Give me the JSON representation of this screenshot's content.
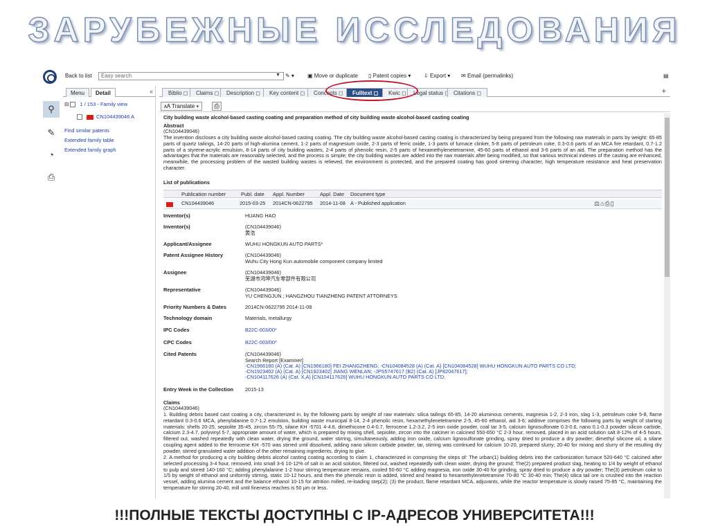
{
  "slide": {
    "title": "ЗАРУБЕЖНЫЕ  ИССЛЕДОВАНИЯ",
    "footer": "!!!ПОЛНЫЕ ТЕКСТЫ ДОСТУПНЫ С IP-АДРЕСОВ УНИВЕРСИТЕТА!!!"
  },
  "topbar": {
    "back_to_list": "Back to list",
    "search_placeholder": "Easy search",
    "move_or_duplicate": "Move or duplicate",
    "patent_copies": "Patent copies",
    "export": "Export",
    "email": "Email (permalinks)"
  },
  "leftpanel": {
    "tabs": [
      "Menu",
      "Detail"
    ],
    "collapse": "«",
    "family_label": "1 / 153 - Family view",
    "family_member": "CN104439046 A",
    "links": [
      "Find similar patents",
      "Extended family table",
      "Extended family graph"
    ]
  },
  "tabs": [
    {
      "label": "Biblio",
      "active": false
    },
    {
      "label": "Claims",
      "active": false
    },
    {
      "label": "Description",
      "active": false
    },
    {
      "label": "Key content",
      "active": false
    },
    {
      "label": "Concepts",
      "active": false
    },
    {
      "label": "Fulltext",
      "active": true
    },
    {
      "label": "Kwic",
      "active": false
    },
    {
      "label": "Legal status",
      "active": false
    },
    {
      "label": "Citations",
      "active": false
    }
  ],
  "toolbar2": {
    "translate": "Translate"
  },
  "document": {
    "title": "City building waste alcohol-based casting coating and preparation method of city building waste alcohol-based casting coating",
    "abstract_heading": "Abstract",
    "abstract_id": "(CN104439046)",
    "abstract_text": "The invention discloses a city building waste alcohol-based casting coating. The city building waste alcohol-based casting coating is characterized by being prepared from the following raw materials in parts by weight: 65-85 parts of quartz tailings, 14-20 parts of high-alumina cement, 1-2 parts of magnesium oxide, 2-3 parts of ferric oxide, 1-3 parts of furnace clinker, 5-8 parts of petroleum coke, 0.3-0.6 parts of an MCA fire retardant, 0.7-1.2 parts of a styrene-acrylic emulsion, 8-14 parts of city building wastes, 2-4 parts of phenolic resin, 2-5 parts of hexamethylenetetramine, 45-60 parts of ethanol and 3-6 parts of an aid. The preparation method has the advantages that the materials are reasonably selected, and the process is simple; the city building wastes are added into the raw materials after being modified, so that various technical indexes of the casting are enhanced, meanwhile, the processing problem of the wasted building wastes is relieved, the environment is protected, and the prepared coating has good sintering character, high temperature resistance and heat preservation character.",
    "list_heading": "List of publications",
    "pub_columns": [
      "Publication number",
      "Publ. date",
      "Appl. Number",
      "Appl. Date",
      "Document type"
    ],
    "pub_row": [
      "CN104439046",
      "2015-03-25",
      "2014CN-0622795",
      "2014-11-08",
      "A - Published application"
    ],
    "fields": [
      {
        "label": "Inventor(s)",
        "value": "HUANG HAO"
      },
      {
        "label": "Inventor(s)",
        "value": "(CN104439046)",
        "value2": "黄浩"
      },
      {
        "label": "Applicant/Assignee",
        "value": "WUHU HONGKUN AUTO PARTS*"
      },
      {
        "label": "Patent Assignee History",
        "value": "(CN104439046)",
        "value2": "Wuhu City Hong Kun automobile component company limited"
      },
      {
        "label": "Assignee",
        "value": "(CN104439046)",
        "value2": "芜湖市鸿坤汽车零部件有限公司"
      },
      {
        "label": "Representative",
        "value": "(CN104439046)",
        "value2": "YU CHENGJUN ; HANGZHOU TIANZHENG PATENT ATTORNEYS"
      },
      {
        "label": "Priority Numbers & Dates",
        "value": "2014CN-0622795 2014-11-08"
      },
      {
        "label": "Technology domain",
        "value": "Materials, metallurgy"
      },
      {
        "label": "IPC Codes",
        "value": "B22C-003/00*"
      },
      {
        "label": "CPC Codes",
        "value": "B22C-003/00*"
      }
    ],
    "cited": {
      "label": "Cited Patents",
      "id": "(CN104439046)",
      "search_report": "Search Report [Examiner]",
      "lines": [
        "-CN1966180 (A) (Cat. A) [CN1966180] FEI ZHANGZHENG;  -CN104084528 (A) (Cat. A) [CN104084528] WUHU HONGKUN AUTO PARTS CO LTD;",
        "-CN1923402 (A) (Cat. A) [CN1923402] JIANG WENLAN;  -JPS5747617 (B2) (Cat. A) [JP82047617];",
        "-CN104117626 (A) (Cat. X,A) [CN104117626] WUHU HONGKUN AUTO PARTS CO LTD;"
      ]
    },
    "entry_week": {
      "label": "Entry Week in the Collection",
      "value": "2015-13"
    },
    "claims_heading": "Claims",
    "claims_id": "(CN104439046)",
    "claim1": "1. Building debris based cast coating a city, characterized in, by the following parts by weight of raw materials: silica tailings 65-85, 14-20 aluminous cements, magnesia 1-2, 2-3 iron, slag 1-3, petroleum coke 5-8, flame retardant 0.3-0.6 MCA, phenylalanine 0.7-1.2 emulsion, building waste municipal 8-14, 2-4 phenolic resin, hexamethylenetetramine 2-5, 45-60 ethanol, aid 3-6; additive comprises the following parts by weight of starting materials: shells 20-25, sepiolite 35-45, zircon 55-75, silane KH -5701 4-4.6, dimethicone 0.4-0.7, ferrocene 1.2-3.2, 2-5 iron oxide powder, coal tar 3-5, calcium lignosulfonate 0.3-0.6, nano 0.1-0.3 powder silicon carbide, calcium 2.3-4.7, polyvinyl 5-7, appropriate amount of water, which is prepared by mixing shell, sepiolite, zircon into the calciner in calcined 550-650 °C 2-3 hour, removed, placed in an acid solution salt 8-12% of 4-5 hours, filtered out, washed repeatedly with clean water, drying the ground, water stirring, simultaneously, adding iron oxide, calcium lignosulfonate grinding, spray dried to produce a dry powder; dimethyl silicone oil, a silane coupling agent added to the ferrocene KH -570 was stirred until dissolved, adding nano silicon carbide powder, tar, stirring was continued for calcium 10-20, prepared slurry; 20-40 for mixing and slurry of the resulting dry powder, stirred granulated water addition of the other remaining ingredients, drying to give.",
    "claim2": "2. A method for producing a city building debris alcohol casting coating according to claim 1, characterized in comprising the steps of: The urban(1) building debris into the carbonization furnace 520-640 °C calcined after selected processing 3-4 hour, removed, into small 3-6 10-12% of salt in an acid solution, filtered out, washed repeatedly with clean water, drying the ground; The(2) prepared product slag, heating to 1/4 by weight of ethanol to pulp and stirred 140-160 °C; adding phenylalanine 1-2 hour stirring temperature remains, cooled 50-60 °C adding magnesia, iron oxide 30-40 for grinding, spray dried to produce a dry powder; The(3) petroleum coke to 1/5 by weight of ethanol and uniformly stirring, static 10-12 hours, and then the phenolic resin is added, stirred and heated to hexamethylenetetramine 70-80 °C 30-40 min; The(4) silica tail ore is crushed into the reaction vessel, adding alumina cement and the balance ethanol 10-15 for attrition milled, re-loading step(2); (3) the product, flame retardant MCA, adjuvants, while the reactor temperature is slowly raised 75-85 °C, maintaining the temperature for stirring 20-40, mill until fineness reaches is 50 μm or less."
  },
  "icons": {
    "logo": "globe-logo-icon",
    "rail": [
      "search-user-icon",
      "edit-icon",
      "chart-icon",
      "pdf-icon"
    ]
  },
  "colors": {
    "active_tab": "#2b4e87",
    "highlight": "#c0182a",
    "link": "#1a3fae"
  }
}
